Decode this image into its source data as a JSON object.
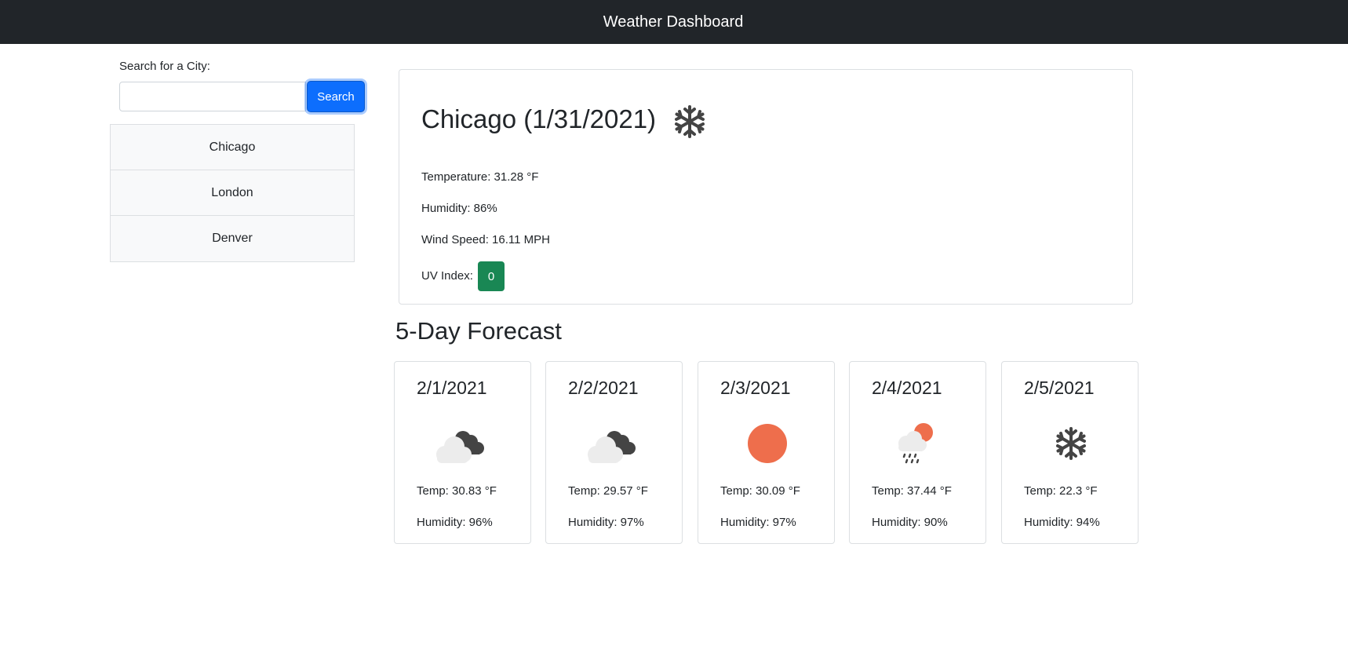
{
  "header": {
    "title": "Weather Dashboard"
  },
  "search": {
    "label": "Search for a City:",
    "value": "",
    "placeholder": "",
    "button_label": "Search"
  },
  "history": [
    "Chicago",
    "London",
    "Denver"
  ],
  "current": {
    "title": "Chicago (1/31/2021)",
    "icon": "snowflake-icon",
    "temperature": "Temperature: 31.28 °F",
    "humidity": "Humidity: 86%",
    "wind": "Wind Speed: 16.11 MPH",
    "uv_label": "UV Index:",
    "uv_value": "0",
    "uv_color": "#198754"
  },
  "forecast_heading": "5-Day Forecast",
  "forecast": [
    {
      "date": "2/1/2021",
      "icon": "cloudy-night-icon",
      "temp": "Temp: 30.83 °F",
      "humidity": "Humidity: 96%"
    },
    {
      "date": "2/2/2021",
      "icon": "cloudy-night-icon",
      "temp": "Temp: 29.57 °F",
      "humidity": "Humidity: 97%"
    },
    {
      "date": "2/3/2021",
      "icon": "sun-icon",
      "temp": "Temp: 30.09 °F",
      "humidity": "Humidity: 97%"
    },
    {
      "date": "2/4/2021",
      "icon": "rain-sun-icon",
      "temp": "Temp: 37.44 °F",
      "humidity": "Humidity: 90%"
    },
    {
      "date": "2/5/2021",
      "icon": "snowflake-icon",
      "temp": "Temp: 22.3 °F",
      "humidity": "Humidity: 94%"
    }
  ],
  "colors": {
    "navbar": "#212529",
    "accent": "#0d6efd",
    "sun": "#ee6e4c",
    "cloud": "#eeeeee",
    "dark_cloud": "#444444"
  }
}
